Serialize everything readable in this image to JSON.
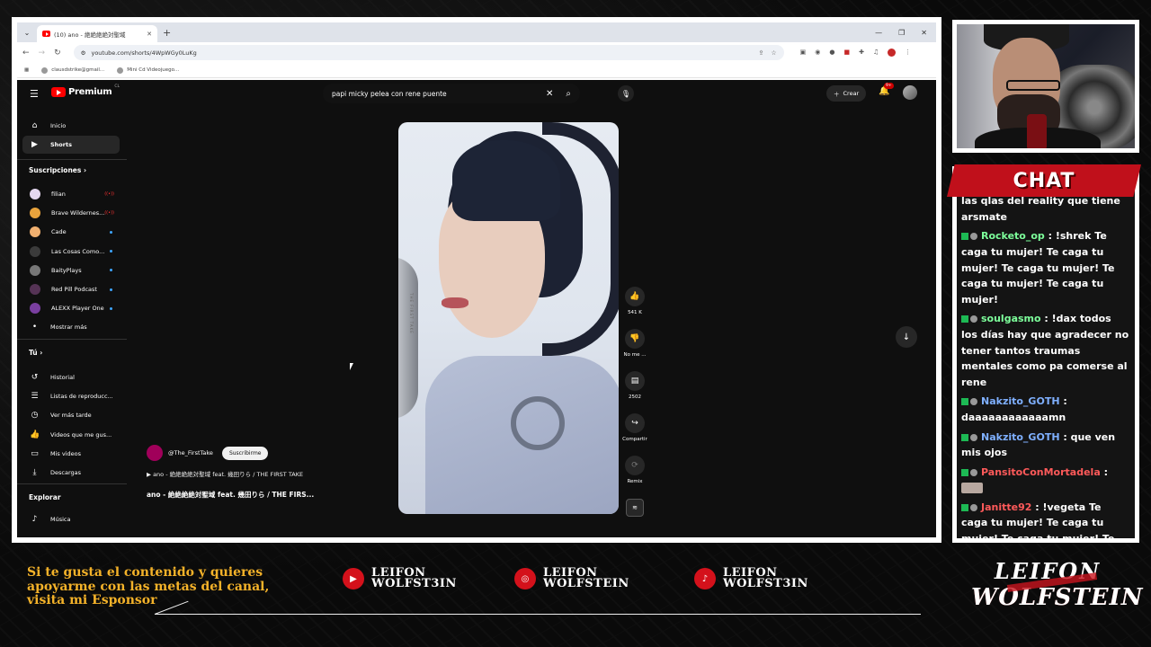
{
  "browser": {
    "tab_title": "(10) ano - 絶絶絶絶対聖域",
    "url": "youtube.com/shorts/4WpWGy0LuKg",
    "bookmarks": [
      "clausdstrike@gmail...",
      "Mini Cd Videojuego..."
    ]
  },
  "youtube": {
    "logo_text": "Premium",
    "logo_country": "CL",
    "search_query": "papi micky pelea con rene puente",
    "create_label": "Crear",
    "notif_badge": "9+",
    "sidebar": {
      "main": [
        {
          "label": "Inicio",
          "icon": "home-icon"
        },
        {
          "label": "Shorts",
          "icon": "shorts-icon",
          "active": true
        }
      ],
      "subs_header": "Suscripciones",
      "subs": [
        {
          "label": "filian",
          "color": "#e4d7ef",
          "live": true
        },
        {
          "label": "Brave Wildernes...",
          "color": "#e8a33c",
          "live": true
        },
        {
          "label": "Cade",
          "color": "#f0b070",
          "dot": true
        },
        {
          "label": "Las Cosas Como...",
          "color": "#3b3b3b",
          "dot": true
        },
        {
          "label": "BaityPlays",
          "color": "#777777",
          "dot": true
        },
        {
          "label": "Red Pill Podcast",
          "color": "#553355",
          "dot": true
        },
        {
          "label": "ALEXX Player One",
          "color": "#7a3fa0",
          "dot": true
        }
      ],
      "show_more": "Mostrar más",
      "you_header": "Tú",
      "you": [
        {
          "label": "Historial",
          "icon": "history-icon"
        },
        {
          "label": "Listas de reproducc...",
          "icon": "playlist-icon"
        },
        {
          "label": "Ver más tarde",
          "icon": "clock-icon"
        },
        {
          "label": "Videos que me gus...",
          "icon": "thumbs-up-icon"
        },
        {
          "label": "Mis videos",
          "icon": "my-videos-icon"
        },
        {
          "label": "Descargas",
          "icon": "download-icon"
        }
      ],
      "explore_header": "Explorar",
      "explore": [
        {
          "label": "Música",
          "icon": "music-icon"
        }
      ]
    },
    "short": {
      "watermark": "THE FIRST TAKE",
      "channel": "@The_FirstTake",
      "subscribe": "Suscribirme",
      "song": "▶ ano - 絶絶絶絶対聖域 feat. 幾田りら / THE FIRST TAKE",
      "title": "ano - 絶絶絶絶対聖域 feat. 幾田りら / THE FIRS...",
      "likes": "541 K",
      "dislike": "No me ...",
      "comments": "2502",
      "share": "Compartir",
      "remix": "Remix"
    }
  },
  "chat": {
    "title": "CHAT",
    "messages": [
      {
        "user": "Nakzito_GOTH",
        "color": "#7fb0ff",
        "text": ": verdad que ese qlo está con una de las qlas del reality que tiene arsmate"
      },
      {
        "user": "Rocketo_op",
        "color": "#7dff9b",
        "text": ": !shrek Te caga tu mujer! Te caga tu mujer! Te caga tu mujer! Te caga tu mujer! Te caga tu mujer!"
      },
      {
        "user": "soulgasmo",
        "color": "#7dff9b",
        "text": ": !dax todos los días hay que agradecer no tener tantos traumas mentales como pa comerse al rene"
      },
      {
        "user": "Nakzito_GOTH",
        "color": "#7fb0ff",
        "text": ": daaaaaaaaaaaamn"
      },
      {
        "user": "Nakzito_GOTH",
        "color": "#7fb0ff",
        "text": ": que ven mis ojos"
      },
      {
        "user": "PansitoConMortadela",
        "color": "#ff5a5a",
        "text": ":"
      },
      {
        "user": "Janitte92",
        "color": "#ff5a5a",
        "text": ": !vegeta Te caga tu mujer! Te caga tu mujer! Te caga tu mujer! Te caga tu mujer!"
      }
    ]
  },
  "overlay": {
    "promo": "Si te gusta el contenido y quieres apoyarme con las metas del canal, visita mi Esponsor",
    "socials": [
      {
        "platform": "youtube",
        "icon": "youtube-icon",
        "l1": "LEIFON",
        "l2": "WOLFST3IN"
      },
      {
        "platform": "instagram",
        "icon": "instagram-icon",
        "l1": "LEIFON",
        "l2": "WOLFSTEIN"
      },
      {
        "platform": "tiktok",
        "icon": "tiktok-icon",
        "l1": "LEIFON",
        "l2": "WOLFST3IN"
      }
    ],
    "brand_l1": "LEIFON",
    "brand_l2": "WOLFSTEIN",
    "accent": "#f4b229",
    "red": "#c0101b"
  }
}
